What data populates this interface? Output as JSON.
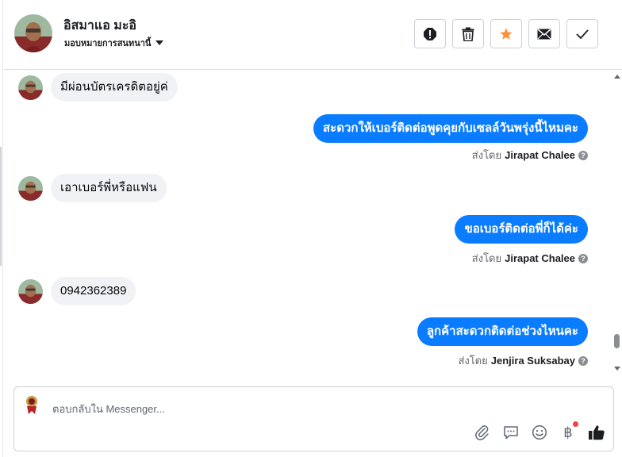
{
  "header": {
    "contact_name": "อิสมาแอ มะอิ",
    "assign_label": "มอบหมายการสนทนานี้",
    "toolbar": [
      {
        "name": "spam-button",
        "icon": "alert-icon"
      },
      {
        "name": "delete-button",
        "icon": "trash-icon"
      },
      {
        "name": "star-button",
        "icon": "star-icon"
      },
      {
        "name": "mark-unread-button",
        "icon": "envelope-icon"
      },
      {
        "name": "mark-done-button",
        "icon": "check-icon"
      }
    ]
  },
  "colors": {
    "outgoing_bubble": "#0a7cff",
    "incoming_bubble": "#f0f2f5",
    "star": "#f7923b",
    "notification_dot": "#fa3e3e"
  },
  "messages": [
    {
      "direction": "in",
      "text": "มีผ่อนบัตรเครดิตอยู่ค่"
    },
    {
      "direction": "out",
      "text": "สะดวกให้เบอร์ติดต่อพูดคุยกับเซลล์วันพรุ่งนี้ไหมคะ",
      "sent_by_prefix": "ส่งโดย",
      "agent": "Jirapat Chalee"
    },
    {
      "direction": "in",
      "text": "เอาเบอร์พี่หรือแฟน"
    },
    {
      "direction": "out",
      "text": "ขอเบอร์ติดต่อพี่ก็ได้ค่ะ",
      "sent_by_prefix": "ส่งโดย",
      "agent": "Jirapat Chalee"
    },
    {
      "direction": "in",
      "text": "0942362389"
    },
    {
      "direction": "out",
      "text": "ลูกค้าสะดวกติดต่อช่วงไหนคะ",
      "sent_by_prefix": "ส่งโดย",
      "agent": "Jenjira Suksabay"
    }
  ],
  "composer": {
    "placeholder": "ตอบกลับใน Messenger...",
    "tools": [
      "paperclip-icon",
      "chat-bubble-icon",
      "emoji-icon",
      "baht-icon",
      "thumbs-up-icon"
    ],
    "baht_symbol": "฿"
  }
}
